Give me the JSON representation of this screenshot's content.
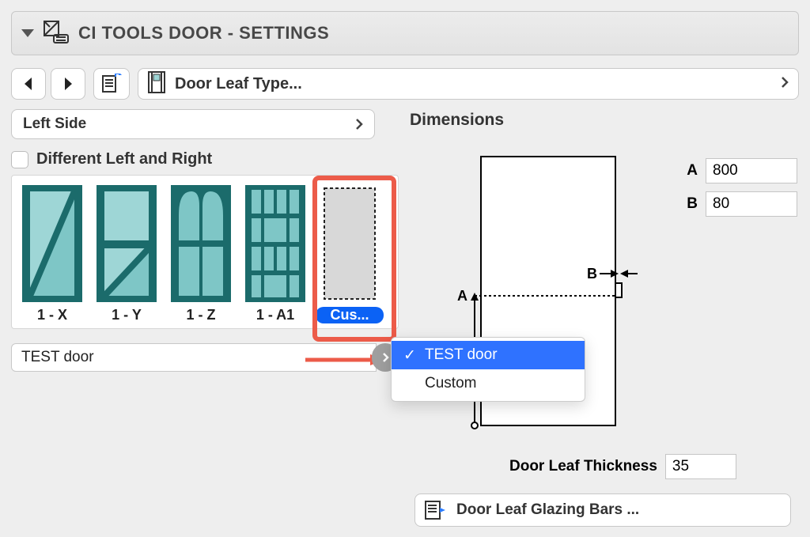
{
  "header": {
    "title": "CI TOOLS DOOR - SETTINGS"
  },
  "toolbar": {
    "door_type_label": "Door Leaf Type..."
  },
  "left_panel": {
    "side_label": "Left Side",
    "diff_label": "Different Left and Right",
    "thumbs": [
      {
        "label": "1 - X"
      },
      {
        "label": "1 - Y"
      },
      {
        "label": "1 - Z"
      },
      {
        "label": "1 - A1"
      },
      {
        "label": "Cus..."
      }
    ],
    "dropdown_value": "TEST door"
  },
  "dimensions": {
    "title": "Dimensions",
    "a_label": "A",
    "a_value": "800",
    "b_label": "B",
    "b_value": "80",
    "thickness_label": "Door Leaf Thickness",
    "thickness_value": "35",
    "glazing_label": "Door Leaf Glazing Bars ..."
  },
  "menu": {
    "items": [
      "TEST door",
      "Custom"
    ],
    "selected_index": 0
  },
  "colors": {
    "teal_dark": "#1b6b6b",
    "teal_light": "#7ec6c6",
    "selection": "#0b62f5",
    "highlight": "#ec5b49"
  }
}
